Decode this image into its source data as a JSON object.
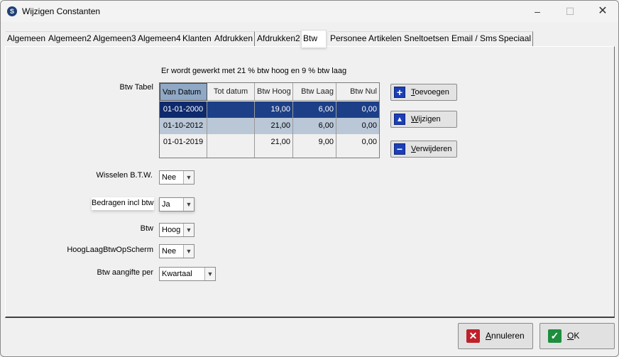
{
  "window": {
    "title": "Wijzigen Constanten",
    "minimize": "–",
    "maximize": "☐",
    "close": "✕"
  },
  "tabs": [
    {
      "label": "Algemeen"
    },
    {
      "label": "Algemeen2"
    },
    {
      "label": "Algemeen3"
    },
    {
      "label": "Algemeen4"
    },
    {
      "label": "Klanten"
    },
    {
      "label": "Afdrukken"
    },
    {
      "label": "Afdrukken2"
    },
    {
      "label": "Btw"
    },
    {
      "label": "Personeel"
    },
    {
      "label": "Artikelen"
    },
    {
      "label": "Sneltoetsen"
    },
    {
      "label": "Email / Sms"
    },
    {
      "label": "Speciaal"
    }
  ],
  "active_tab": "Btw",
  "info_text": "Er wordt gewerkt met 21 % btw hoog en 9 % btw laag",
  "btw_tabel": {
    "label": "Btw Tabel",
    "columns": [
      "Van Datum",
      "Tot datum",
      "Btw Hoog",
      "Btw Laag",
      "Btw Nul"
    ],
    "rows": [
      [
        "01-01-2000",
        "",
        "19,00",
        "6,00",
        "0,00"
      ],
      [
        "01-10-2012",
        "",
        "21,00",
        "6,00",
        "0,00"
      ],
      [
        "01-01-2019",
        "",
        "21,00",
        "9,00",
        "0,00"
      ]
    ]
  },
  "buttons": {
    "toevoegen": {
      "u": "T",
      "rest": "oevoegen",
      "icon": "plus-icon"
    },
    "wijzigen": {
      "u": "W",
      "rest": "ijzigen",
      "icon": "triangle-up-icon"
    },
    "verwijderen": {
      "u": "V",
      "rest": "erwijderen",
      "icon": "minus-icon"
    }
  },
  "fields": {
    "wisselen": {
      "label": "Wisselen B.T.W.",
      "value": "Nee"
    },
    "bedragen": {
      "label": "Bedragen incl btw",
      "value": "Ja"
    },
    "btw": {
      "label": "Btw",
      "value": "Hoog"
    },
    "hooglaag": {
      "label": "HoogLaagBtwOpScherm",
      "value": "Nee"
    },
    "aangifte": {
      "label": "Btw aangifte per",
      "value": "Kwartaal"
    }
  },
  "footer": {
    "annuleren": {
      "u": "A",
      "rest": "nnuleren",
      "icon": "x-icon",
      "color": "#c0202a"
    },
    "ok": {
      "u": "O",
      "rest": "K",
      "icon": "check-icon",
      "color": "#1e8e3e"
    }
  }
}
